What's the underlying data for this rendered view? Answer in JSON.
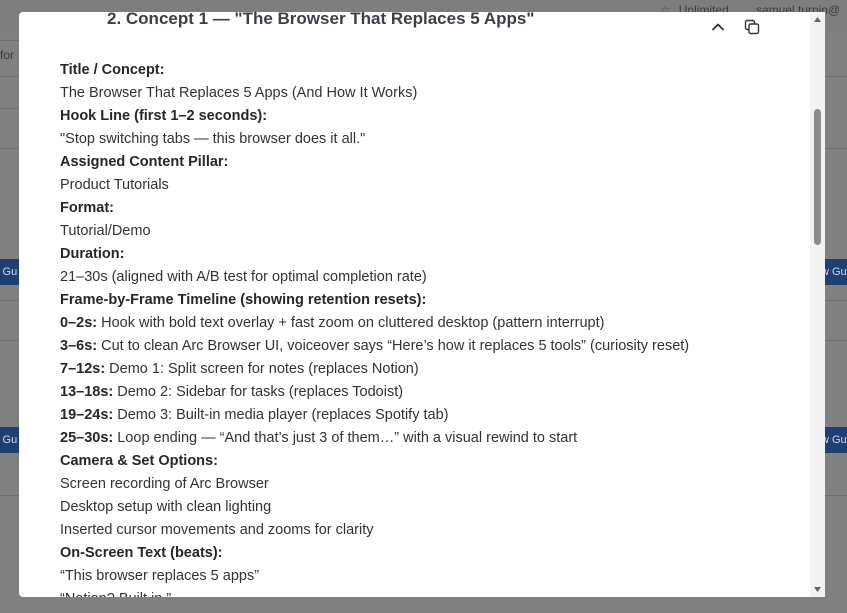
{
  "background": {
    "plan_label": "Unlimited",
    "user_email": "samuel.turpin@",
    "side_label": "for",
    "button_left": "y Gu",
    "button_right": "w Gu"
  },
  "modal": {
    "heading": "2. Concept 1 — \"The Browser That Replaces 5 Apps\"",
    "rows": [
      {
        "type": "label",
        "text": "Title / Concept:"
      },
      {
        "type": "text",
        "text": "The Browser That Replaces 5 Apps (And How It Works)"
      },
      {
        "type": "label",
        "text": "Hook Line (first 1–2 seconds):"
      },
      {
        "type": "text",
        "text": "\"Stop switching tabs — this browser does it all.\""
      },
      {
        "type": "label",
        "text": "Assigned Content Pillar:"
      },
      {
        "type": "text",
        "text": "Product Tutorials"
      },
      {
        "type": "label",
        "text": "Format:"
      },
      {
        "type": "text",
        "text": "Tutorial/Demo"
      },
      {
        "type": "label",
        "text": "Duration:"
      },
      {
        "type": "text",
        "text": "21–30s (aligned with A/B test for optimal completion rate)"
      },
      {
        "type": "label",
        "text": "Frame-by-Frame Timeline (showing retention resets):"
      },
      {
        "type": "timed",
        "time": "0–2s:",
        "text": " Hook with bold text overlay + fast zoom on cluttered desktop (pattern interrupt)"
      },
      {
        "type": "timed",
        "time": "3–6s:",
        "text": " Cut to clean Arc Browser UI, voiceover says “Here’s how it replaces 5 tools” (curiosity reset)"
      },
      {
        "type": "timed",
        "time": "7–12s:",
        "text": " Demo 1: Split screen for notes (replaces Notion)"
      },
      {
        "type": "timed",
        "time": "13–18s:",
        "text": " Demo 2: Sidebar for tasks (replaces Todoist)"
      },
      {
        "type": "timed",
        "time": "19–24s:",
        "text": " Demo 3: Built-in media player (replaces Spotify tab)"
      },
      {
        "type": "timed",
        "time": "25–30s:",
        "text": " Loop ending — “And that’s just 3 of them…” with a visual rewind to start"
      },
      {
        "type": "label",
        "text": "Camera & Set Options:"
      },
      {
        "type": "text",
        "text": "Screen recording of Arc Browser"
      },
      {
        "type": "text",
        "text": "Desktop setup with clean lighting"
      },
      {
        "type": "text",
        "text": "Inserted cursor movements and zooms for clarity"
      },
      {
        "type": "label",
        "text": "On-Screen Text (beats):"
      },
      {
        "type": "text",
        "text": "“This browser replaces 5 apps”"
      },
      {
        "type": "text",
        "text": "“Notion? Built in.”"
      }
    ]
  },
  "icons": {
    "collapse": "chevron-up-icon",
    "copy": "copy-icon",
    "scroll_up": "triangle-up-icon",
    "scroll_down": "triangle-down-icon"
  },
  "colors": {
    "overlay": "#808080",
    "button_blue": "#1e3f73",
    "heading_text": "#3b3f46",
    "body_text": "#2f3338"
  }
}
